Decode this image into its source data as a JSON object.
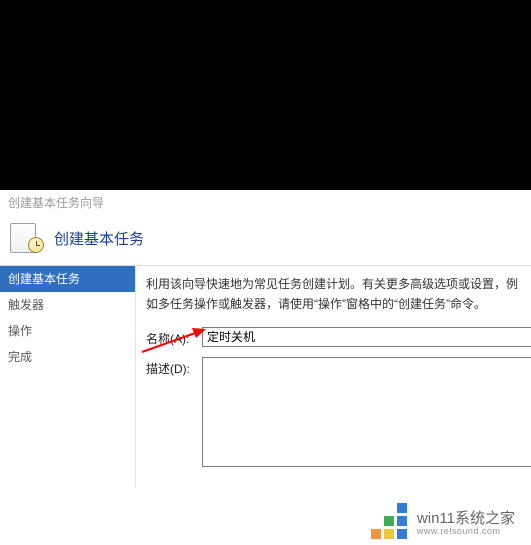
{
  "window": {
    "title": "创建基本任务向导"
  },
  "header": {
    "title": "创建基本任务"
  },
  "sidebar": {
    "items": [
      {
        "label": "创建基本任务",
        "active": true
      },
      {
        "label": "触发器",
        "active": false
      },
      {
        "label": "操作",
        "active": false
      },
      {
        "label": "完成",
        "active": false
      }
    ]
  },
  "main": {
    "intro": "利用该向导快速地为常见任务创建计划。有关更多高级选项或设置，例如多任务操作或触发器，请使用“操作”窗格中的“创建任务”命令。",
    "name_label": "名称(A):",
    "name_value": "定时关机",
    "desc_label": "描述(D):",
    "desc_value": ""
  },
  "watermark": {
    "brand": "win11系统之家",
    "url": "www.relsound.com"
  },
  "colors": {
    "sidebar_active_bg": "#2f6fbf",
    "header_title": "#1a3e99",
    "arrow": "#ff0000"
  }
}
